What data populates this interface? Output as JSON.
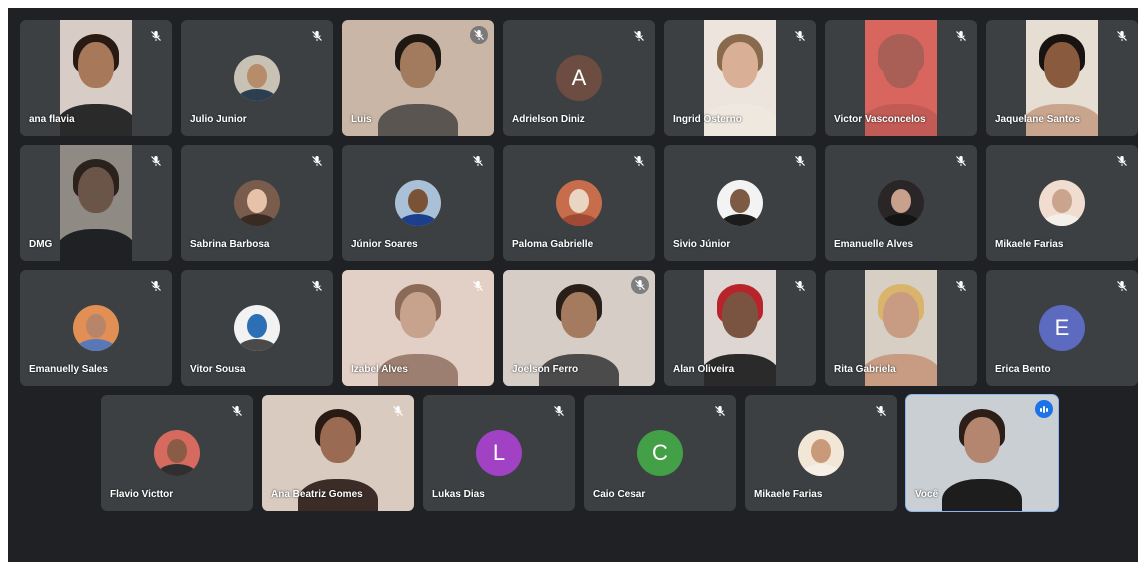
{
  "meeting": {
    "participants": [
      {
        "name": "ana flavia",
        "kind": "video",
        "mic_icon": "mic-off-icon",
        "skin": "#a8785a",
        "hair": "#2a1a14",
        "clothes": "#2a2a2a",
        "bg": "#d8ccc6"
      },
      {
        "name": "Julio Junior",
        "kind": "photo",
        "mic_icon": "mic-off-icon",
        "photo_bg": "#c7c2b4",
        "skin": "#b78c6a",
        "clothes": "#2c3e50"
      },
      {
        "name": "Luis",
        "kind": "video",
        "mic_icon": "mic-off-icon",
        "skin": "#a27a5e",
        "hair": "#1e1712",
        "clothes": "#5a5550",
        "bg": "#c9b6a6"
      },
      {
        "name": "Adrielson Diniz",
        "kind": "letter",
        "letter": "A",
        "letter_color": "#6d4c41",
        "mic_icon": "mic-off-icon"
      },
      {
        "name": "Ingrid Osterno",
        "kind": "video",
        "mic_icon": "mic-off-icon",
        "skin": "#d9b095",
        "hair": "#8a6a4c",
        "clothes": "#efe8df",
        "bg": "#ece4dd"
      },
      {
        "name": "Victor Vasconcelos",
        "kind": "video",
        "mic_icon": "mic-off-icon",
        "skin": "#a95e56",
        "hair": "#a95e56",
        "clothes": "#c25a55",
        "bg": "#d8665f"
      },
      {
        "name": "Jaquelane Santos",
        "kind": "video",
        "mic_icon": "mic-off-icon",
        "skin": "#8a5a3e",
        "hair": "#181210",
        "clothes": "#c9a58e",
        "bg": "#e6ddd3"
      },
      {
        "name": "DMG",
        "kind": "video",
        "mic_icon": "mic-off-icon",
        "skin": "#6b5548",
        "hair": "#2b221d",
        "clothes": "#1f2124",
        "bg": "#8f8a84"
      },
      {
        "name": "Sabrina Barbosa",
        "kind": "photo",
        "mic_icon": "mic-off-icon",
        "photo_bg": "#7a5c4c",
        "skin": "#e6c2a8",
        "clothes": "#3a2a24"
      },
      {
        "name": "Júnior Soares",
        "kind": "photo",
        "mic_icon": "mic-off-icon",
        "photo_bg": "#a9c0d6",
        "skin": "#7a5236",
        "clothes": "#1b3f8c"
      },
      {
        "name": "Paloma Gabrielle",
        "kind": "photo",
        "mic_icon": "mic-off-icon",
        "photo_bg": "#c76d4c",
        "skin": "#e8d5c2",
        "clothes": "#a04a36"
      },
      {
        "name": "Sivio Júnior",
        "kind": "photo",
        "mic_icon": "mic-off-icon",
        "photo_bg": "#f3f3f3",
        "skin": "#7d5a44",
        "clothes": "#1c1c1c"
      },
      {
        "name": "Emanuelle Alves",
        "kind": "photo",
        "mic_icon": "mic-off-icon",
        "photo_bg": "#2a2627",
        "skin": "#c8a08c",
        "clothes": "#141414"
      },
      {
        "name": "Mikaele Farias",
        "kind": "photo",
        "mic_icon": "mic-off-icon",
        "photo_bg": "#f0ddd0",
        "skin": "#caa48c",
        "clothes": "#f4efe9"
      },
      {
        "name": "Emanuelly Sales",
        "kind": "photo",
        "mic_icon": "mic-off-icon",
        "photo_bg": "#e28f55",
        "skin": "#b8846a",
        "clothes": "#5a78b8"
      },
      {
        "name": "Vitor Sousa",
        "kind": "photo",
        "mic_icon": "mic-off-icon",
        "photo_bg": "#f2f2f2",
        "skin": "#2c6fb5",
        "clothes": "#4a4a4a"
      },
      {
        "name": "Izabel Alves",
        "kind": "video",
        "mic_icon": "mic-off-icon",
        "skin": "#c7a28c",
        "hair": "#8b6a58",
        "clothes": "#9c7f70",
        "bg": "#e2d0c6"
      },
      {
        "name": "Joelson Ferro",
        "kind": "video",
        "mic_icon": "mic-off-icon",
        "skin": "#a47b5f",
        "hair": "#2a1f18",
        "clothes": "#4b4b4b",
        "bg": "#d6cdc6"
      },
      {
        "name": "Alan Oliveira",
        "kind": "video",
        "mic_icon": "mic-off-icon",
        "skin": "#7a5440",
        "hair": "#b8242b",
        "clothes": "#2a2a2a",
        "bg": "#ddd6d2"
      },
      {
        "name": "Rita Gabriela",
        "kind": "video",
        "mic_icon": "mic-off-icon",
        "skin": "#c79c82",
        "hair": "#d9b46a",
        "clothes": "#c79c82",
        "bg": "#d8cfc4"
      },
      {
        "name": "Erica Bento",
        "kind": "letter",
        "letter": "E",
        "letter_color": "#5c6bc0",
        "mic_icon": "mic-off-icon"
      },
      {
        "name": "Flavio Victtor",
        "kind": "photo",
        "mic_icon": "mic-off-icon",
        "photo_bg": "#d66a5e",
        "skin": "#8a5c45",
        "clothes": "#2f2f2f"
      },
      {
        "name": "Ana Beatriz Gomes",
        "kind": "video",
        "mic_icon": "mic-off-icon",
        "skin": "#9a6a52",
        "hair": "#2a1a14",
        "clothes": "#3b2c27",
        "bg": "#d9cbc0"
      },
      {
        "name": "Lukas Dias",
        "kind": "letter",
        "letter": "L",
        "letter_color": "#a142c4",
        "mic_icon": "mic-off-icon"
      },
      {
        "name": "Caio Cesar",
        "kind": "letter",
        "letter": "C",
        "letter_color": "#43a047",
        "mic_icon": "mic-off-icon"
      },
      {
        "name": "Mikaele Farias",
        "kind": "photo",
        "mic_icon": "mic-off-icon",
        "photo_bg": "#f2e6d6",
        "skin": "#c99a7a",
        "clothes": "#f5efe6"
      },
      {
        "name": "Você",
        "kind": "video",
        "mic_icon": "speaking-indicator-icon",
        "self": true,
        "skin": "#b48670",
        "hair": "#2d1e18",
        "clothes": "#1d1d1d",
        "bg": "#c9cfd3"
      }
    ]
  }
}
